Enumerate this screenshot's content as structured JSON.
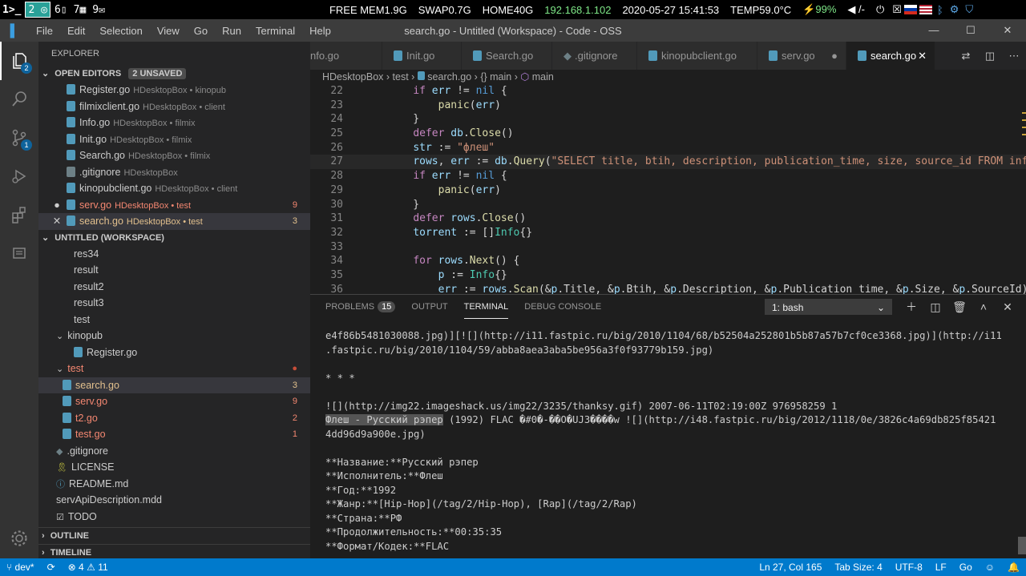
{
  "system_bar": {
    "workspaces": [
      "1",
      "2",
      "6",
      "7",
      "9"
    ],
    "free_mem": "FREE MEM1.9G",
    "swap": "SWAP0.7G",
    "home": "HOME40G",
    "ip": "192.168.1.102",
    "datetime": "2020-05-27 15:41:53",
    "temp": "TEMP59.0°C",
    "battery": "⚡99%",
    "volume": "◀ /-"
  },
  "menu": [
    "File",
    "Edit",
    "Selection",
    "View",
    "Go",
    "Run",
    "Terminal",
    "Help"
  ],
  "window_title": "search.go - Untitled (Workspace) - Code - OSS",
  "activity_badges": {
    "explorer": "2",
    "scm": "1"
  },
  "explorer": {
    "header": "EXPLORER",
    "open_editors_title": "OPEN EDITORS",
    "unsaved": "2 UNSAVED",
    "open_editors": [
      {
        "name": "Register.go",
        "desc": "HDesktopBox • kinopub"
      },
      {
        "name": "filmixclient.go",
        "desc": "HDesktopBox • client"
      },
      {
        "name": "Info.go",
        "desc": "HDesktopBox • filmix"
      },
      {
        "name": "Init.go",
        "desc": "HDesktopBox • filmix"
      },
      {
        "name": "Search.go",
        "desc": "HDesktopBox • filmix"
      },
      {
        "name": ".gitignore",
        "desc": "HDesktopBox"
      },
      {
        "name": "kinopubclient.go",
        "desc": "HDesktopBox • client"
      },
      {
        "name": "serv.go",
        "desc": "HDesktopBox • test",
        "count": "9"
      },
      {
        "name": "search.go",
        "desc": "HDesktopBox • test",
        "count": "3"
      }
    ],
    "workspace_title": "UNTITLED (WORKSPACE)",
    "tree": [
      {
        "name": "res34"
      },
      {
        "name": "result"
      },
      {
        "name": "result2"
      },
      {
        "name": "result3"
      },
      {
        "name": "test"
      },
      {
        "name": "kinopub"
      },
      {
        "name": "Register.go"
      },
      {
        "name": "test"
      },
      {
        "name": "search.go",
        "count": "3"
      },
      {
        "name": "serv.go",
        "count": "9"
      },
      {
        "name": "t2.go",
        "count": "2"
      },
      {
        "name": "test.go",
        "count": "1"
      },
      {
        "name": ".gitignore"
      },
      {
        "name": "LICENSE"
      },
      {
        "name": "README.md"
      },
      {
        "name": "servApiDescription.mdd"
      },
      {
        "name": "TODO"
      }
    ],
    "outline": "OUTLINE",
    "timeline": "TIMELINE"
  },
  "tabs": [
    {
      "label": "nfo.go"
    },
    {
      "label": "Init.go"
    },
    {
      "label": "Search.go"
    },
    {
      "label": ".gitignore"
    },
    {
      "label": "kinopubclient.go"
    },
    {
      "label": "serv.go"
    },
    {
      "label": "search.go"
    }
  ],
  "breadcrumb": [
    "HDesktopBox",
    "test",
    "search.go",
    "{} main",
    "main"
  ],
  "code": [
    {
      "n": "22",
      "t": "    if err != nil {"
    },
    {
      "n": "23",
      "t": "        panic(err)"
    },
    {
      "n": "24",
      "t": "    }"
    },
    {
      "n": "25",
      "t": "    defer db.Close()"
    },
    {
      "n": "26",
      "t": "    str := \"флеш\""
    },
    {
      "n": "27",
      "t": "    rows, err := db.Query(\"SELECT title, btih, description, publication_time, size, source_id FROM info W"
    },
    {
      "n": "28",
      "t": "    if err != nil {"
    },
    {
      "n": "29",
      "t": "        panic(err)"
    },
    {
      "n": "30",
      "t": "    }"
    },
    {
      "n": "31",
      "t": "    defer rows.Close()"
    },
    {
      "n": "32",
      "t": "    torrent := []Info{}"
    },
    {
      "n": "33",
      "t": ""
    },
    {
      "n": "34",
      "t": "    for rows.Next() {"
    },
    {
      "n": "35",
      "t": "        p := Info{}"
    },
    {
      "n": "36",
      "t": "        err := rows.Scan(&p.Title, &p.Btih, &p.Description, &p.Publication_time, &p.Size, &p.SourceId)"
    }
  ],
  "panel": {
    "tabs": [
      "PROBLEMS",
      "OUTPUT",
      "TERMINAL",
      "DEBUG CONSOLE"
    ],
    "problems_count": "15",
    "terminal_select": "1: bash",
    "lines": [
      "e4f86b5481030088.jpg)][![](http://i11.fastpic.ru/big/2010/1104/68/b52504a252801b5b87a57b7cf0ce3368.jpg)](http://i11",
      ".fastpic.ru/big/2010/1104/59/abba8aea3aba5be956a3f0f93779b159.jpg)",
      "",
      "* * *",
      "",
      "![](http://img22.imageshack.us/img22/3235/thanksy.gif) 2007-06-11T02:19:00Z 976958259 1",
      "Флеш - Русский рэпер (1992) FLAC �#0�-��O�UJ3����w ![](http://i48.fastpic.ru/big/2012/1118/0e/3826c4a69db825f85421",
      "4dd96d9a900e.jpg)",
      "",
      "**Название:**Русский рэпер",
      "**Исполнитель:**Флеш",
      "**Год:**1992",
      "**Жанр:**[Hip-Hop](/tag/2/Hip-Hop), [Rap](/tag/2/Rap)",
      "**Страна:**РФ",
      "**Продолжительность:**00:35:35",
      "**Формат/Кодек:**FLAC"
    ],
    "highlight": "Флеш - Русский рэпер"
  },
  "status": {
    "branch": "dev*",
    "errors": "4",
    "warnings": "11",
    "position": "Ln 27, Col 165",
    "tabsize": "Tab Size: 4",
    "encoding": "UTF-8",
    "eol": "LF",
    "language": "Go"
  },
  "colors": {
    "accent": "#007acc",
    "ws_active": "#2aa198",
    "modified": "#e2c08d",
    "error": "#f48771"
  }
}
